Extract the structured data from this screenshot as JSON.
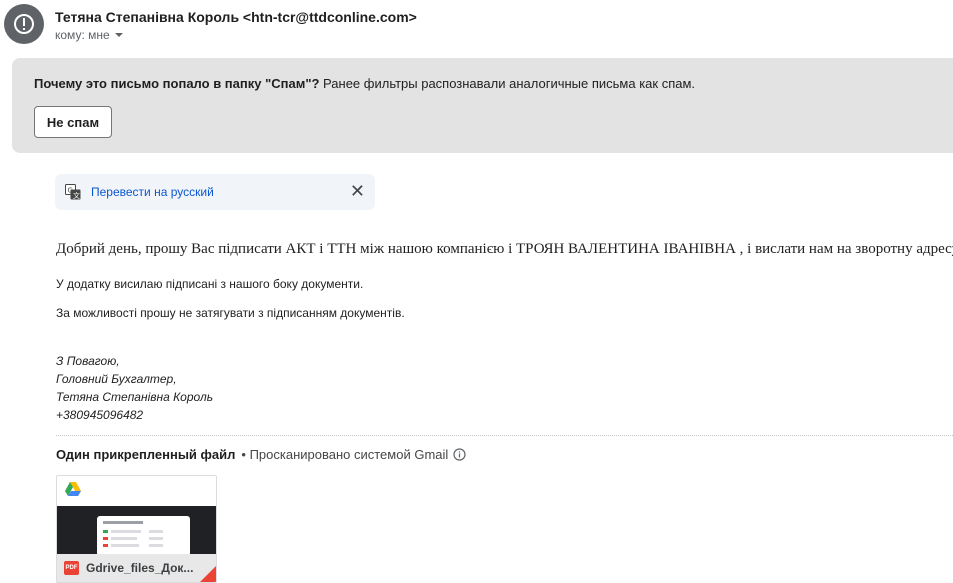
{
  "header": {
    "sender": "Тетяна Степанівна Король <htn-tcr@ttdconline.com>",
    "recipient": "кому: мне"
  },
  "spam_notice": {
    "question": "Почему это письмо попало в папку \"Спам\"?",
    "explanation": " Ранее фильтры распознавали аналогичные письма как спам.",
    "not_spam_label": "Не спам"
  },
  "translate": {
    "link": "Перевести на русский",
    "close": "✕"
  },
  "body": {
    "line1": "Добрий день, прошу Вас підписати АКТ і ТТН між нашою компанією і ТРОЯН ВАЛЕНТИНА ІВАНІВНА , і вислати нам на зворотну адресу.",
    "line2": "У додатку висилаю підписані з нашого боку документи.",
    "line3": "За можливості прошу не затягувати з підписанням документів."
  },
  "signature": {
    "lines": [
      "З Повагою,",
      "Головний Бухгалтер,",
      "Тетяна Степанівна Король",
      "+380945096482"
    ]
  },
  "attachments": {
    "count_label": "Один прикрепленный файл",
    "scanned_label": "• Просканировано системой Gmail",
    "file_name": "Gdrive_files_Док...",
    "file_type": "PDF"
  },
  "colors": {
    "spam_bg": "#e3e3e3",
    "link": "#0b57d0",
    "pdf_red": "#ea4335"
  }
}
